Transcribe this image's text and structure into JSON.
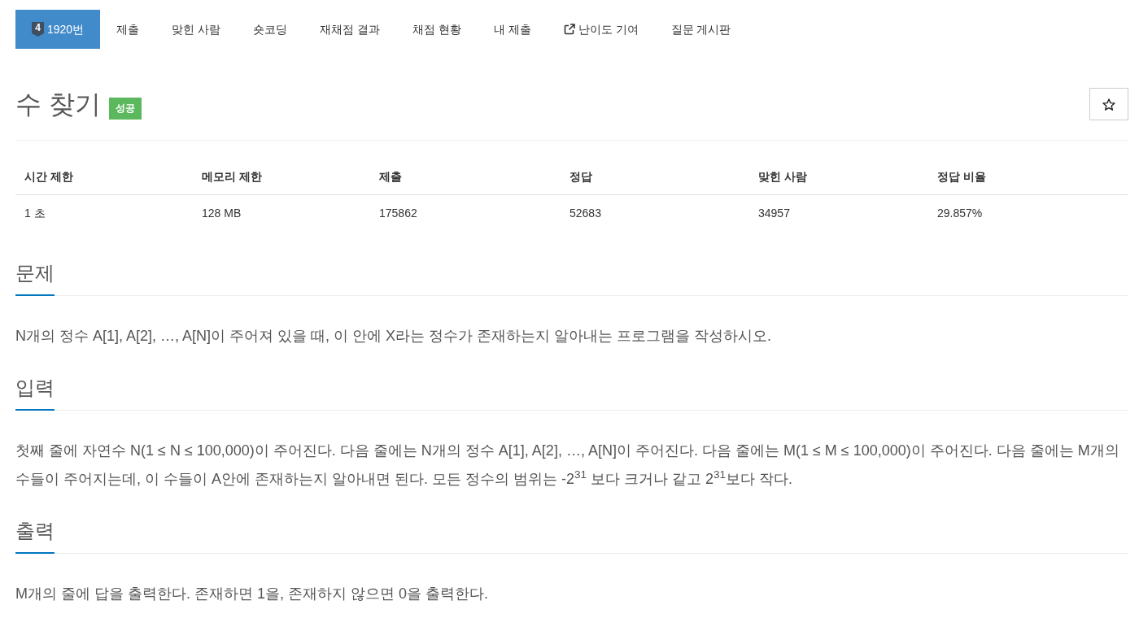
{
  "tabs": [
    {
      "label": "1920번",
      "selected": true,
      "badge": "4"
    },
    {
      "label": "제출",
      "selected": false
    },
    {
      "label": "맞힌 사람",
      "selected": false
    },
    {
      "label": "숏코딩",
      "selected": false
    },
    {
      "label": "재채점 결과",
      "selected": false
    },
    {
      "label": "채점 현황",
      "selected": false
    },
    {
      "label": "내 제출",
      "selected": false
    },
    {
      "label": "난이도 기여",
      "selected": false,
      "external": true
    },
    {
      "label": "질문 게시판",
      "selected": false
    }
  ],
  "title": {
    "text": "수 찾기",
    "status": "성공",
    "starred": false
  },
  "table": {
    "columns": [
      "시간 제한",
      "메모리 제한",
      "제출",
      "정답",
      "맞힌 사람",
      "정답 비율"
    ],
    "rows": [
      [
        "1 초",
        "128 MB",
        "175862",
        "52683",
        "34957",
        "29.857%"
      ]
    ]
  },
  "sections": [
    {
      "heading": "문제",
      "paragraphs": [
        "N개의 정수 A[1], A[2], …, A[N]이 주어져 있을 때, 이 안에 X라는 정수가 존재하는지 알아내는 프로그램을 작성하시오."
      ]
    },
    {
      "heading": "입력",
      "paragraphs": [
        "첫째 줄에 자연수 N(1 ≤ N ≤ 100,000)이 주어진다. 다음 줄에는 N개의 정수 A[1], A[2], …, A[N]이 주어진다. 다음 줄에는 M(1 ≤ M ≤ 100,000)이 주어진다. 다음 줄에는 M개의 수들이 주어지는데, 이 수들이 A안에 존재하는지 알아내면 된다. 모든 정수의 범위는 -2$^{31}$ 보다 크거나 같고 2$^{31}$보다 작다."
      ]
    },
    {
      "heading": "출력",
      "paragraphs": [
        "M개의 줄에 답을 출력한다. 존재하면 1을, 존재하지 않으면 0을 출력한다."
      ]
    }
  ]
}
